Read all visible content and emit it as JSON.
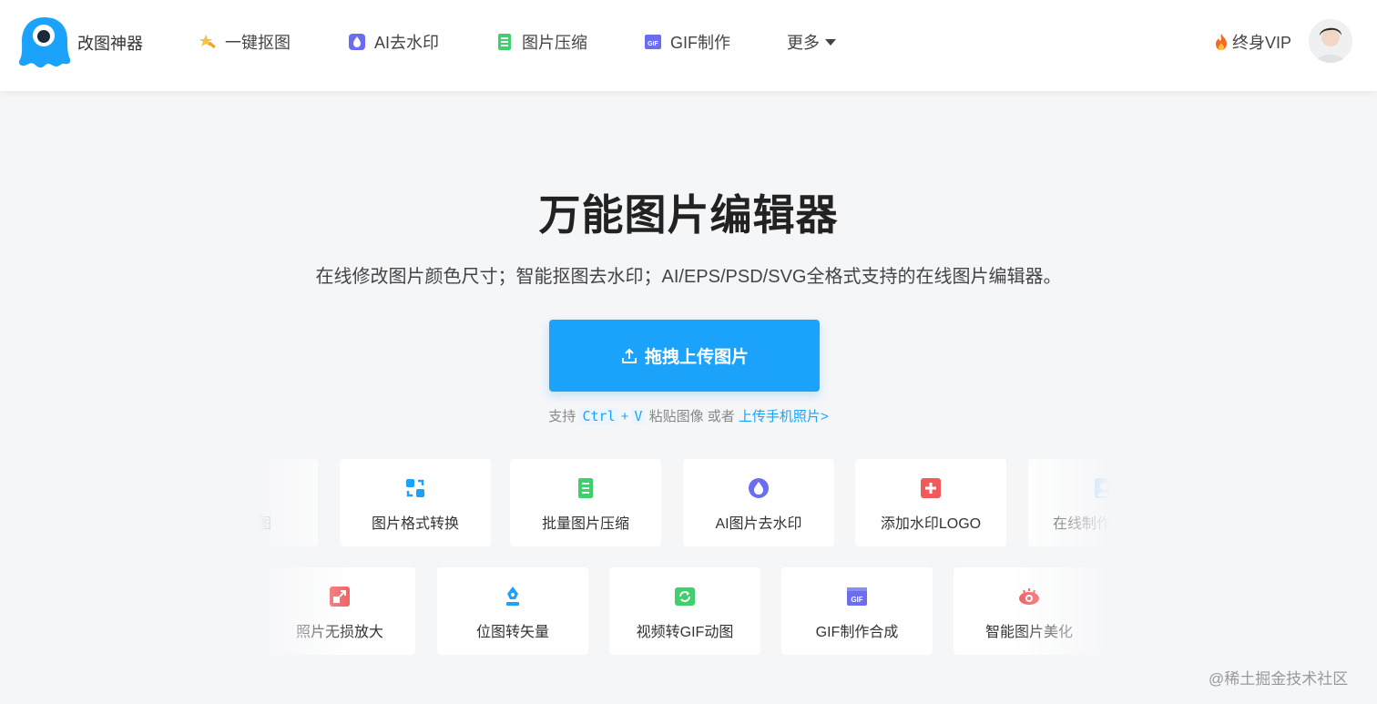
{
  "header": {
    "brand": "改图神器",
    "nav": [
      {
        "label": "一键抠图",
        "icon": "magic-wand-icon"
      },
      {
        "label": "AI去水印",
        "icon": "water-drop-icon"
      },
      {
        "label": "图片压缩",
        "icon": "compress-icon"
      },
      {
        "label": "GIF制作",
        "icon": "gif-icon"
      },
      {
        "label": "更多",
        "icon": "chevron-down-icon"
      }
    ],
    "vip_label": "终身VIP",
    "vip_icon": "fire-icon"
  },
  "hero": {
    "title": "万能图片编辑器",
    "subtitle": "在线修改图片颜色尺寸；智能抠图去水印；AI/EPS/PSD/SVG全格式支持的在线图片编辑器。",
    "upload_label": "拖拽上传图片",
    "hint_prefix": "支持",
    "hint_key1": "Ctrl",
    "hint_plus": "+",
    "hint_key2": "V",
    "hint_mid": "粘贴图像 或者",
    "hint_link": "上传手机照片>"
  },
  "tools_row1": [
    {
      "label": "一键抠图",
      "icon": "cutout-icon",
      "color": "#f0a32a"
    },
    {
      "label": "图片格式转换",
      "icon": "convert-icon",
      "color": "#1ba3fb"
    },
    {
      "label": "批量图片压缩",
      "icon": "compress-icon",
      "color": "#3fcf6d"
    },
    {
      "label": "AI图片去水印",
      "icon": "water-drop-icon",
      "color": "#6b6df0"
    },
    {
      "label": "添加水印LOGO",
      "icon": "plus-icon",
      "color": "#f05a5a"
    },
    {
      "label": "在线制作证件照",
      "icon": "id-photo-icon",
      "color": "#5aa7f5"
    }
  ],
  "tools_row2": [
    {
      "label": "照片无损放大",
      "icon": "enlarge-icon",
      "color": "#f05a5a"
    },
    {
      "label": "位图转矢量",
      "icon": "pen-icon",
      "color": "#1ba3fb"
    },
    {
      "label": "视频转GIF动图",
      "icon": "video-convert-icon",
      "color": "#3fcf6d"
    },
    {
      "label": "GIF制作合成",
      "icon": "gif-icon",
      "color": "#6b6df0"
    },
    {
      "label": "智能图片美化",
      "icon": "eye-icon",
      "color": "#f05a5a"
    }
  ],
  "watermark": "@稀土掘金技术社区",
  "colors": {
    "accent": "#1ba3fb",
    "background": "#f5f6f8"
  }
}
